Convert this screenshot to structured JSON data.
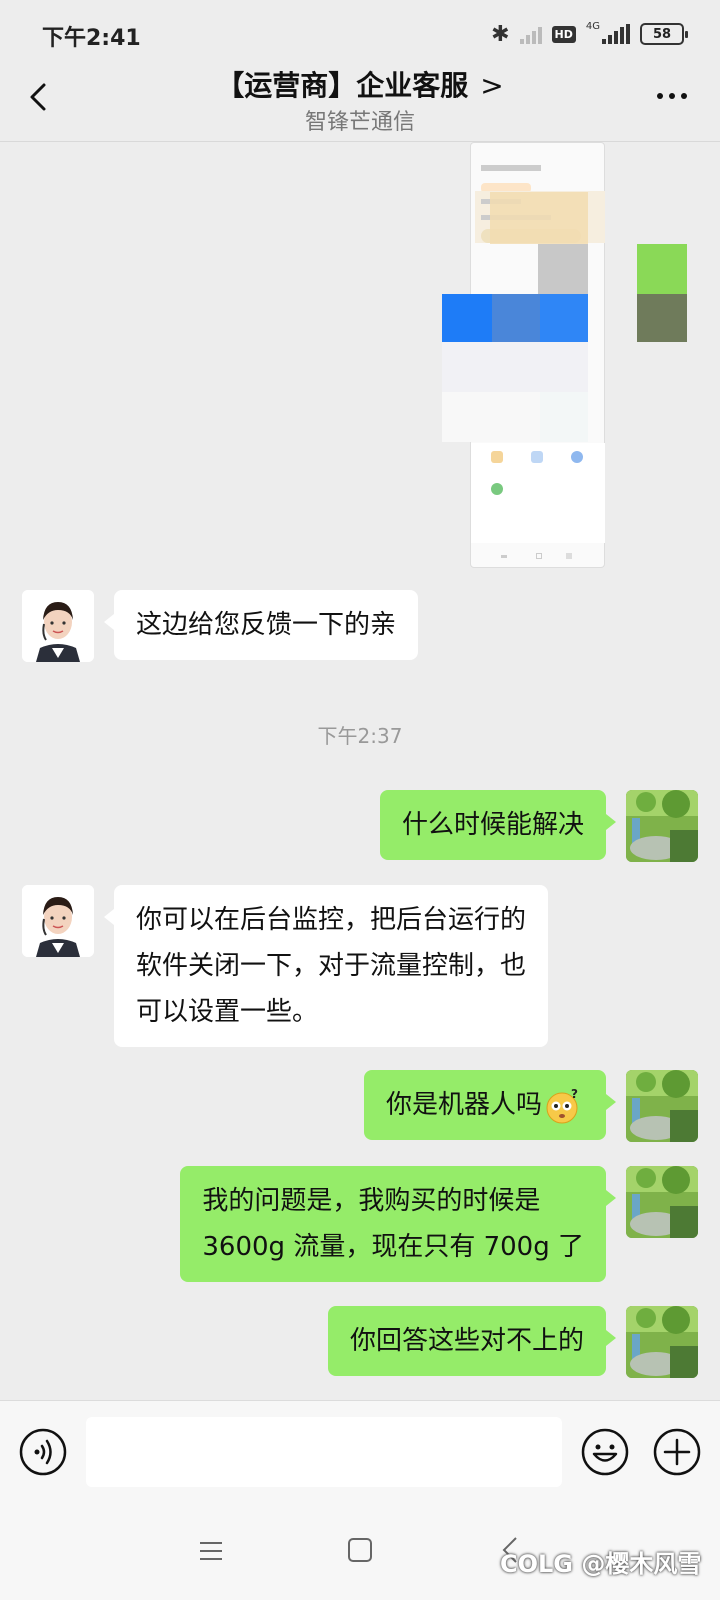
{
  "status_bar": {
    "time": "下午2:41",
    "network": "4G",
    "hd_badge": "HD",
    "battery": "58"
  },
  "header": {
    "title": "【运营商】企业客服",
    "title_chevron": ">",
    "subtitle": "智锋芒通信"
  },
  "messages": [
    {
      "from": "agent",
      "text": "这边给您反馈一下的亲"
    },
    {
      "from": "user",
      "text": "什么时候能解决"
    },
    {
      "from": "agent",
      "lines": [
        "你可以在后台监控，把后台运行的",
        "软件关闭一下，对于流量控制，也",
        "可以设置一些。"
      ]
    },
    {
      "from": "user",
      "text": "你是机器人吗"
    },
    {
      "from": "user",
      "lines": [
        "我的问题是，我购买的时候是",
        "3600g 流量，现在只有 700g 了"
      ]
    },
    {
      "from": "user",
      "text": "你回答这些对不上的"
    }
  ],
  "timestamp": "下午2:37",
  "watermark": "COLG @樱木风雪",
  "colors": {
    "background": "#ededed",
    "outgoing_bubble": "#95ec69",
    "incoming_bubble": "#ffffff"
  },
  "icons": [
    "back-icon",
    "more-icon",
    "voice-icon",
    "emoji-icon",
    "plus-icon",
    "nav-menu-icon",
    "nav-home-icon",
    "nav-back-icon"
  ]
}
